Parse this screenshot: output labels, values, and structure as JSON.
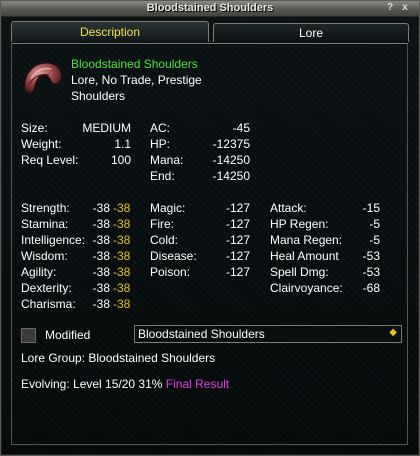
{
  "window": {
    "title": "Bloodstained Shoulders",
    "help_label": "?",
    "close_label": "x"
  },
  "tabs": [
    {
      "label": "Description"
    },
    {
      "label": "Lore"
    }
  ],
  "item": {
    "name": "Bloodstained Shoulders",
    "flags": "Lore, No Trade, Prestige",
    "slot": "Shoulders"
  },
  "basic_stats": {
    "size_label": "Size:",
    "size_value": "MEDIUM",
    "weight_label": "Weight:",
    "weight_value": "1.1",
    "req_label": "Req Level:",
    "req_value": "100",
    "ac_label": "AC:",
    "ac_value": "-45",
    "hp_label": "HP:",
    "hp_value": "-12375",
    "mana_label": "Mana:",
    "mana_value": "-14250",
    "end_label": "End:",
    "end_value": "-14250"
  },
  "attributes": [
    {
      "label": "Strength:",
      "value": "-38",
      "heroic": "-38"
    },
    {
      "label": "Stamina:",
      "value": "-38",
      "heroic": "-38"
    },
    {
      "label": "Intelligence:",
      "value": "-38",
      "heroic": "-38"
    },
    {
      "label": "Wisdom:",
      "value": "-38",
      "heroic": "-38"
    },
    {
      "label": "Agility:",
      "value": "-38",
      "heroic": "-38"
    },
    {
      "label": "Dexterity:",
      "value": "-38",
      "heroic": "-38"
    },
    {
      "label": "Charisma:",
      "value": "-38",
      "heroic": "-38"
    }
  ],
  "resists": [
    {
      "label": "Magic:",
      "value": "-127"
    },
    {
      "label": "Fire:",
      "value": "-127"
    },
    {
      "label": "Cold:",
      "value": "-127"
    },
    {
      "label": "Disease:",
      "value": "-127"
    },
    {
      "label": "Poison:",
      "value": "-127"
    }
  ],
  "mods": [
    {
      "label": "Attack:",
      "value": "-15"
    },
    {
      "label": "HP Regen:",
      "value": "-5"
    },
    {
      "label": "Mana Regen:",
      "value": "-5"
    },
    {
      "label": "Heal Amount",
      "value": "-53"
    },
    {
      "label": "Spell Dmg:",
      "value": "-53"
    },
    {
      "label": "Clairvoyance:",
      "value": "-68"
    }
  ],
  "modified": {
    "label": "Modified",
    "checked": false,
    "select_value": "Bloodstained Shoulders"
  },
  "lore_group": "Lore Group: Bloodstained Shoulders",
  "evolving": {
    "text": "Evolving: Level 15/20 31%",
    "link": "Final Result"
  },
  "colors": {
    "item_name": "#4fe23c",
    "heroic": "#e8c21f",
    "active_tab": "#f2e24a",
    "link": "#e23ce2"
  },
  "icons": {
    "item": "shoulder-armor-icon",
    "dropdown": "diamond-arrow-icon"
  }
}
